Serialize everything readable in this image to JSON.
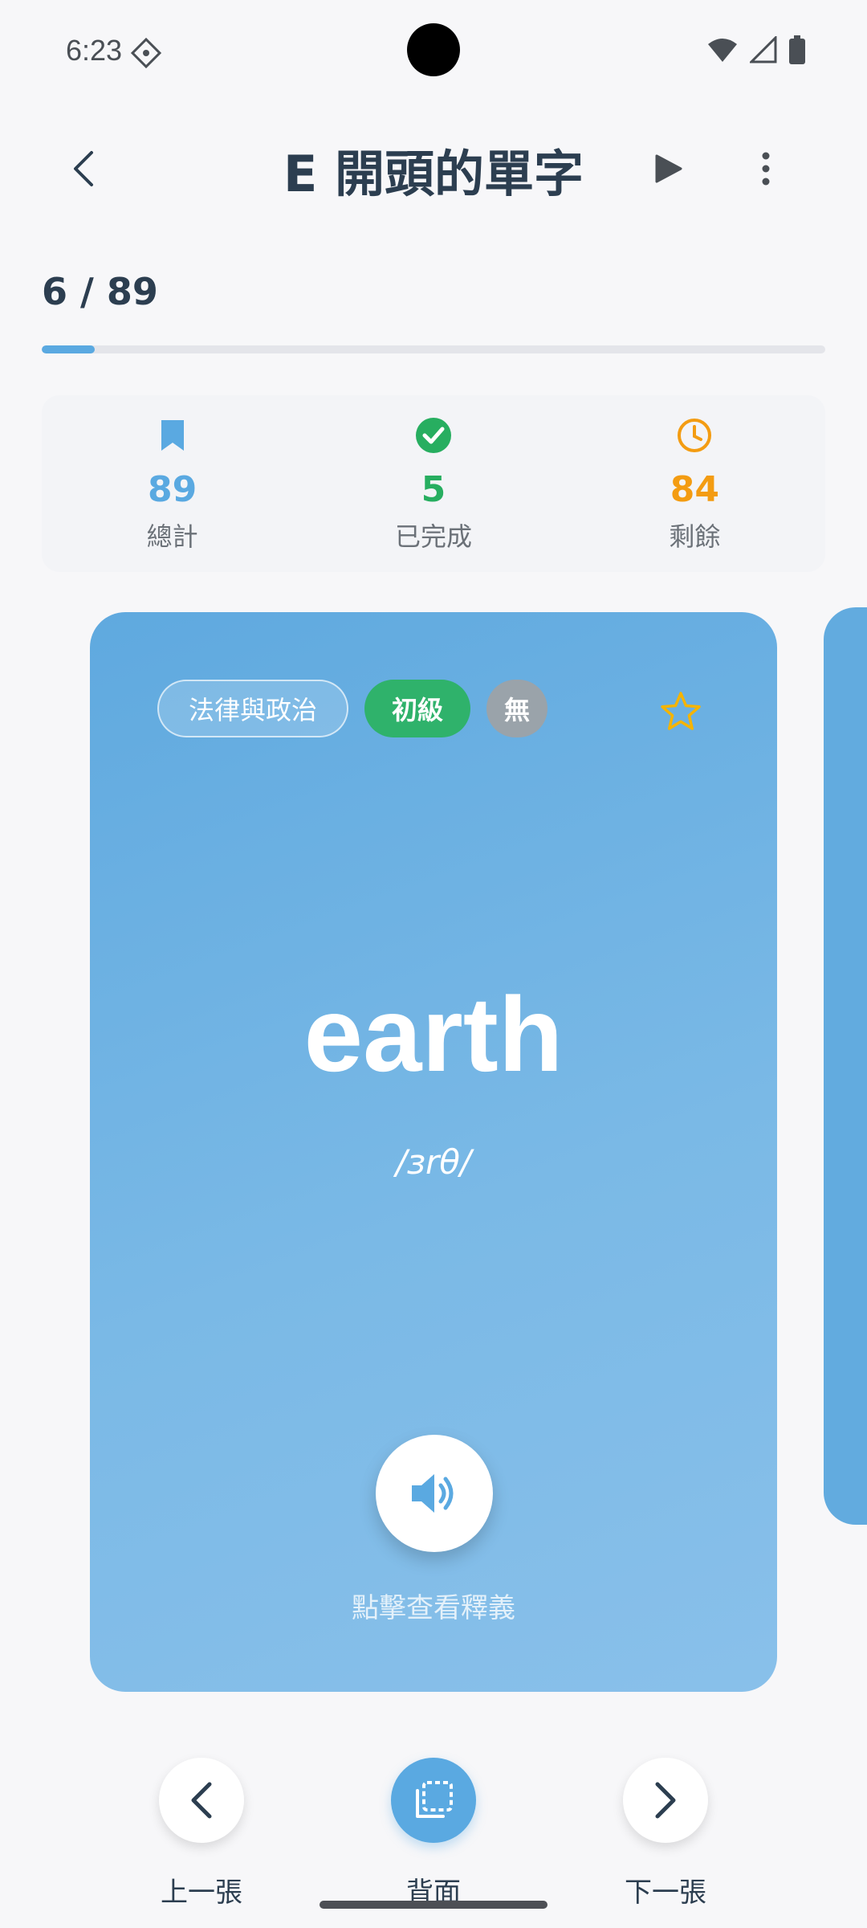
{
  "status_bar": {
    "time": "6:23"
  },
  "app_bar": {
    "title": "E 開頭的單字"
  },
  "progress": {
    "text": "6 / 89",
    "current": 6,
    "total": 89
  },
  "stats": [
    {
      "value": "89",
      "label": "總計",
      "color": "#5aa9e1",
      "icon": "bookmark-icon"
    },
    {
      "value": "5",
      "label": "已完成",
      "color": "#27ae60",
      "icon": "check-circle-icon"
    },
    {
      "value": "84",
      "label": "剩餘",
      "color": "#f39c12",
      "icon": "clock-icon"
    }
  ],
  "card": {
    "category": "法律與政治",
    "level": "初級",
    "tag": "無",
    "word": "earth",
    "phonetic": "/ɜrθ/",
    "hint": "點擊查看釋義"
  },
  "bottom_nav": {
    "prev": "上一張",
    "flip": "背面",
    "next": "下一張"
  },
  "colors": {
    "accent": "#5aa9e1",
    "level": "#2fb26b",
    "star": "#f5b400",
    "title": "#2c3e50"
  }
}
